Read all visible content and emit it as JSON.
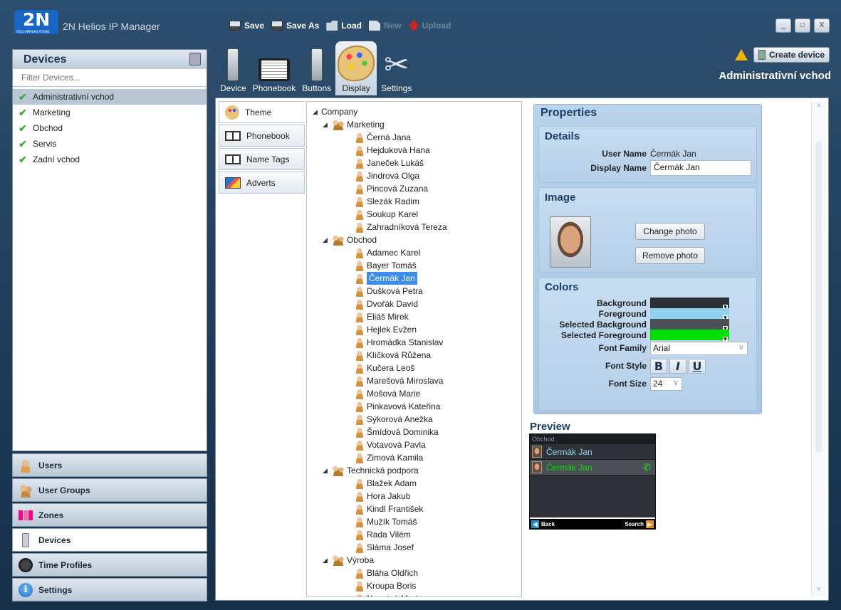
{
  "app": {
    "logo_text": "2N",
    "logo_sub": "TELECOMMUNICATIONS",
    "title": "2N Helios IP Manager"
  },
  "toolbar": {
    "save": "Save",
    "save_as": "Save As",
    "load": "Load",
    "new": "New",
    "upload": "Upload"
  },
  "window_buttons": {
    "minimize": "_",
    "maximize": "□",
    "close": "X"
  },
  "devices_panel": {
    "header": "Devices",
    "filter_placeholder": "Filter Devices...",
    "items": [
      {
        "label": "Administrativní vchod",
        "selected": true
      },
      {
        "label": "Marketing"
      },
      {
        "label": "Obchod"
      },
      {
        "label": "Servis"
      },
      {
        "label": "Zadní vchod"
      }
    ]
  },
  "nav_tabs": [
    {
      "label": "Users",
      "icon": "user-icon"
    },
    {
      "label": "User Groups",
      "icon": "user-group-icon"
    },
    {
      "label": "Zones",
      "icon": "zones-icon"
    },
    {
      "label": "Devices",
      "icon": "device-icon",
      "active": true
    },
    {
      "label": "Time Profiles",
      "icon": "clock-icon"
    },
    {
      "label": "Settings",
      "icon": "info-icon"
    }
  ],
  "main_tabs": [
    {
      "label": "Device",
      "icon": "device-icon"
    },
    {
      "label": "Phonebook",
      "icon": "phonebook-icon"
    },
    {
      "label": "Buttons",
      "icon": "buttons-icon"
    },
    {
      "label": "Display",
      "icon": "palette-icon",
      "active": true
    },
    {
      "label": "Settings",
      "icon": "tools-icon"
    }
  ],
  "header_right": {
    "create_device": "Create device",
    "device_name": "Administrativní vchod"
  },
  "sub_tabs": [
    {
      "label": "Theme",
      "active": true
    },
    {
      "label": "Phonebook"
    },
    {
      "label": "Name Tags"
    },
    {
      "label": "Adverts"
    }
  ],
  "tree": {
    "root": "Company",
    "groups": [
      {
        "name": "Marketing",
        "users": [
          "Černá Jana",
          "Hejduková Hana",
          "Janeček Lukáš",
          "Jindrová Olga",
          "Pincová Zuzana",
          "Slezák Radim",
          "Soukup Karel",
          "Zahradníková Tereza"
        ]
      },
      {
        "name": "Obchod",
        "users": [
          "Adamec Karel",
          "Bayer Tomáš",
          "Čermák Jan",
          "Dušková Petra",
          "Dvořák David",
          "Eliáš Mirek",
          "Hejlek Evžen",
          "Hromádka Stanislav",
          "Klíčková Růžena",
          "Kučera Leoš",
          "Marešová Miroslava",
          "Mošová Marie",
          "Pinkavová Kateřina",
          "Sýkorová Anežka",
          "Šmídová Dominika",
          "Votavová Pavla",
          "Zimová Kamila"
        ]
      },
      {
        "name": "Technická podpora",
        "users": [
          "Blažek Adam",
          "Hora Jakub",
          "Kindl František",
          "Mužík Tomáš",
          "Rada Vilém",
          "Sláma Josef"
        ]
      },
      {
        "name": "Výroba",
        "users": [
          "Bláha Oldřich",
          "Kroupa Boris",
          "Novotná Marie"
        ]
      }
    ],
    "selected_user": "Čermák Jan"
  },
  "properties": {
    "title": "Properties",
    "details": {
      "title": "Details",
      "user_name_label": "User Name",
      "user_name": "Čermák Jan",
      "display_name_label": "Display Name",
      "display_name": "Čermák Jan"
    },
    "image": {
      "title": "Image",
      "change": "Change photo",
      "remove": "Remove photo"
    },
    "colors": {
      "title": "Colors",
      "background_label": "Background",
      "background": "#2b2f35",
      "foreground_label": "Foreground",
      "foreground": "#8ed2f0",
      "selected_background_label": "Selected Background",
      "selected_background": "#4a5055",
      "selected_foreground_label": "Selected Foreground",
      "selected_foreground": "#00e000",
      "font_family_label": "Font Family",
      "font_family": "Arial",
      "font_style_label": "Font Style",
      "bold": "B",
      "italic": "I",
      "underline": "U",
      "font_size_label": "Font Size",
      "font_size": "24"
    }
  },
  "preview": {
    "title": "Preview",
    "header": "Obchod",
    "rows": [
      {
        "name": "Čermák Jan"
      },
      {
        "name": "Čermák Jan"
      }
    ],
    "back": "Back",
    "search": "Search"
  }
}
